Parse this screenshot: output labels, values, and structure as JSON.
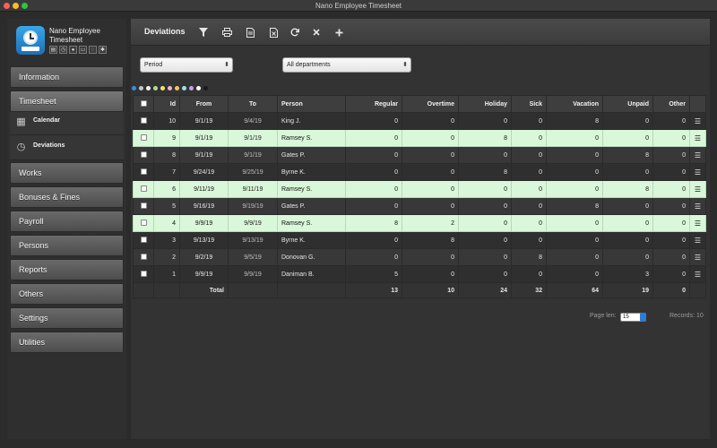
{
  "window": {
    "title": "Nano Employee Timesheet"
  },
  "app": {
    "name_line1": "Nano Employee",
    "name_line2": "Timesheet"
  },
  "sidebar": {
    "nav": [
      {
        "label": "Information"
      },
      {
        "label": "Timesheet"
      },
      {
        "label": "Works"
      },
      {
        "label": "Bonuses & Fines"
      },
      {
        "label": "Payroll"
      },
      {
        "label": "Persons"
      },
      {
        "label": "Reports"
      },
      {
        "label": "Others"
      },
      {
        "label": "Settings"
      },
      {
        "label": "Utilities"
      }
    ],
    "sub": [
      {
        "label": "Calendar",
        "icon": "calendar-icon"
      },
      {
        "label": "Deviations",
        "icon": "clock-icon"
      }
    ]
  },
  "toolbar": {
    "title": "Deviations"
  },
  "filters": {
    "period": {
      "value": "Period"
    },
    "department": {
      "value": "All departments"
    }
  },
  "color_dots": [
    "#3b8fe0",
    "#c8c8c8",
    "#f2f2f2",
    "#a8e28a",
    "#f5e36c",
    "#f0b6d2",
    "#f4c36a",
    "#9ee0e8",
    "#c6a0e8",
    "#ffffff",
    "#1a1a1a"
  ],
  "table": {
    "headers": {
      "id": "Id",
      "from": "From",
      "to": "To",
      "person": "Person",
      "regular": "Regular",
      "overtime": "Overtime",
      "holiday": "Holiday",
      "sick": "Sick",
      "vacation": "Vacation",
      "unpaid": "Unpaid",
      "other": "Other"
    },
    "rows": [
      {
        "id": "10",
        "from": "9/1/19",
        "to": "9/4/19",
        "person": "King J.",
        "regular": "0",
        "overtime": "0",
        "holiday": "0",
        "sick": "0",
        "vacation": "8",
        "unpaid": "0",
        "other": "0",
        "highlight": false
      },
      {
        "id": "9",
        "from": "9/1/19",
        "to": "9/1/19",
        "person": "Ramsey S.",
        "regular": "0",
        "overtime": "0",
        "holiday": "8",
        "sick": "0",
        "vacation": "0",
        "unpaid": "0",
        "other": "0",
        "highlight": true
      },
      {
        "id": "8",
        "from": "9/1/19",
        "to": "9/1/19",
        "person": "Gates P.",
        "regular": "0",
        "overtime": "0",
        "holiday": "0",
        "sick": "0",
        "vacation": "0",
        "unpaid": "8",
        "other": "0",
        "highlight": false
      },
      {
        "id": "7",
        "from": "9/24/19",
        "to": "9/25/19",
        "person": "Byrne K.",
        "regular": "0",
        "overtime": "0",
        "holiday": "8",
        "sick": "0",
        "vacation": "0",
        "unpaid": "0",
        "other": "0",
        "highlight": false
      },
      {
        "id": "6",
        "from": "9/11/19",
        "to": "9/11/19",
        "person": "Ramsey S.",
        "regular": "0",
        "overtime": "0",
        "holiday": "0",
        "sick": "0",
        "vacation": "0",
        "unpaid": "8",
        "other": "0",
        "highlight": true
      },
      {
        "id": "5",
        "from": "9/16/19",
        "to": "9/19/19",
        "person": "Gates P.",
        "regular": "0",
        "overtime": "0",
        "holiday": "0",
        "sick": "0",
        "vacation": "8",
        "unpaid": "0",
        "other": "0",
        "highlight": false
      },
      {
        "id": "4",
        "from": "9/9/19",
        "to": "9/9/19",
        "person": "Ramsey S.",
        "regular": "8",
        "overtime": "2",
        "holiday": "0",
        "sick": "0",
        "vacation": "0",
        "unpaid": "0",
        "other": "0",
        "highlight": true
      },
      {
        "id": "3",
        "from": "9/13/19",
        "to": "9/13/19",
        "person": "Byrne K.",
        "regular": "0",
        "overtime": "8",
        "holiday": "0",
        "sick": "0",
        "vacation": "0",
        "unpaid": "0",
        "other": "0",
        "highlight": false
      },
      {
        "id": "2",
        "from": "9/2/19",
        "to": "9/5/19",
        "person": "Donovan G.",
        "regular": "0",
        "overtime": "0",
        "holiday": "0",
        "sick": "8",
        "vacation": "0",
        "unpaid": "0",
        "other": "0",
        "highlight": false
      },
      {
        "id": "1",
        "from": "9/9/19",
        "to": "9/9/19",
        "person": "Daniman B.",
        "regular": "5",
        "overtime": "0",
        "holiday": "0",
        "sick": "0",
        "vacation": "0",
        "unpaid": "3",
        "other": "0",
        "highlight": false
      }
    ],
    "total": {
      "label": "Total",
      "regular": "13",
      "overtime": "10",
      "holiday": "24",
      "sick": "32",
      "vacation": "64",
      "unpaid": "19",
      "other": "0"
    }
  },
  "footer": {
    "page_len_label": "Page len:",
    "page_len_value": "15",
    "records_label": "Records: 10"
  }
}
